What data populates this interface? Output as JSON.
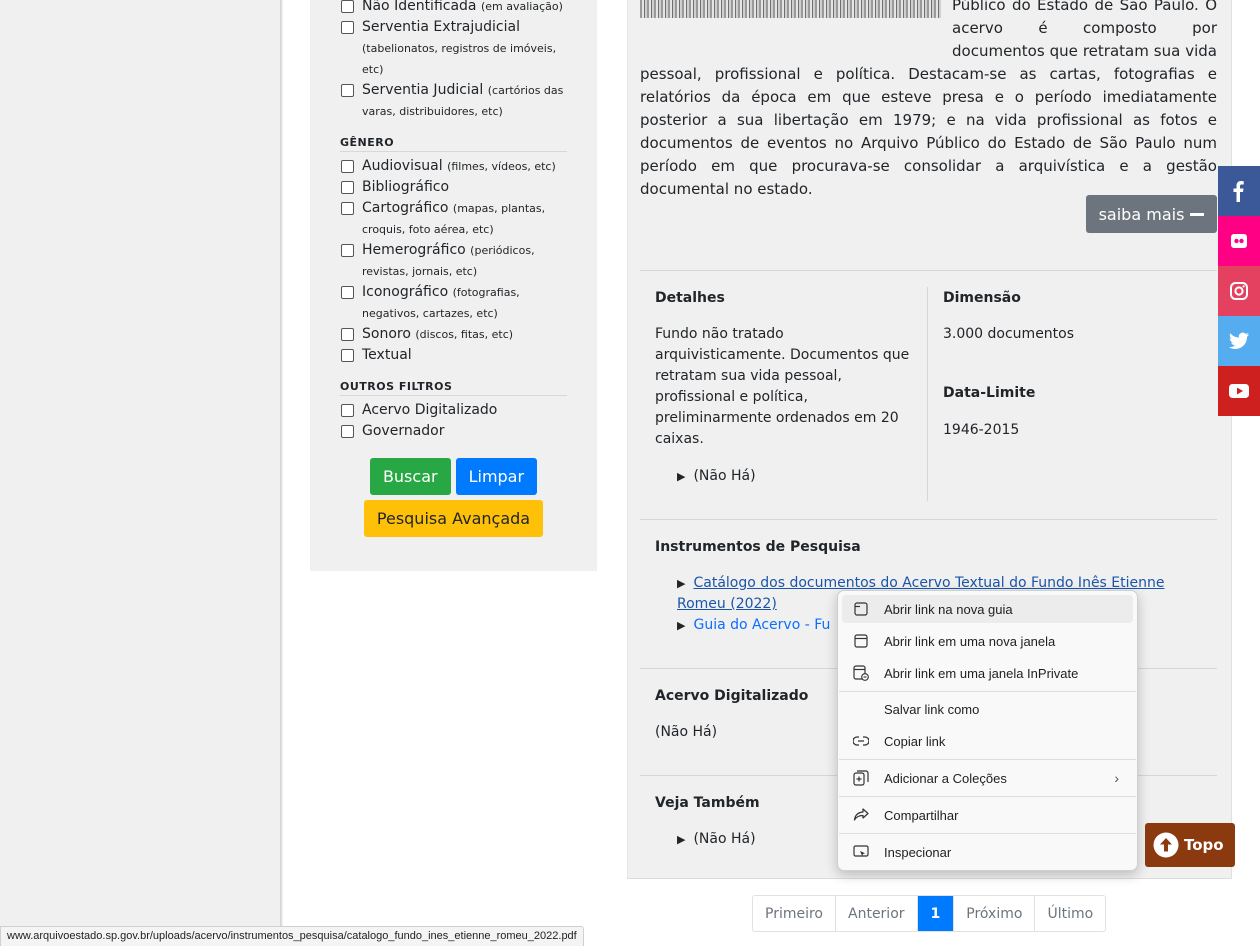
{
  "filters": {
    "items_top": [
      {
        "label": "Não Identificada",
        "note": "(em avaliação)"
      },
      {
        "label": "Serventia Extrajudicial",
        "note": "(tabelionatos, registros de imóveis, etc)"
      },
      {
        "label": "Serventia Judicial",
        "note": "(cartórios das varas, distribuidores, etc)"
      }
    ],
    "genero_title": "GÊNERO",
    "genero": [
      {
        "label": "Audiovisual",
        "note": "(filmes, vídeos, etc)"
      },
      {
        "label": "Bibliográfico",
        "note": ""
      },
      {
        "label": "Cartográfico",
        "note": "(mapas, plantas, croquis, foto aérea, etc)"
      },
      {
        "label": "Hemerográfico",
        "note": "(periódicos, revistas, jornais, etc)"
      },
      {
        "label": "Iconográfico",
        "note": "(fotografias, negativos, cartazes, etc)"
      },
      {
        "label": "Sonoro",
        "note": "(discos, fitas, etc)"
      },
      {
        "label": "Textual",
        "note": ""
      }
    ],
    "outros_title": "OUTROS FILTROS",
    "outros": [
      {
        "label": "Acervo Digitalizado",
        "note": ""
      },
      {
        "label": "Governador",
        "note": ""
      }
    ],
    "buscar_label": "Buscar",
    "limpar_label": "Limpar",
    "avancada_label": "Pesquisa Avançada"
  },
  "description": {
    "text": "Público do Estado de São Paulo. O acervo é composto por documentos que retratam sua vida pessoal, profissional e política. Destacam-se as cartas, fotografias e relatórios da época em que esteve presa e o período imediatamente posterior a sua libertação em 1979; e na vida profissional as fotos e documentos de eventos no Arquivo Público do Estado de São Paulo num período em que procurava-se consolidar a arquivística e a gestão documental no estado.",
    "saiba_label": "saiba mais"
  },
  "details": {
    "detalhes_title": "Detalhes",
    "detalhes_text": "Fundo não tratado arquivisticamente. Documentos que retratam sua vida pessoal, profissional e política, preliminarmente ordenados em 20 caixas.",
    "detalhes_item": "(Não Há)",
    "dimensao_title": "Dimensão",
    "dimensao_value": "3.000 documentos",
    "data_limite_title": "Data-Limite",
    "data_limite_value": "1946-2015"
  },
  "instrumentos": {
    "title": "Instrumentos de Pesquisa",
    "link1": "Catálogo dos documentos do Acervo Textual do Fundo Inês Etienne Romeu (2022)",
    "link2": "Guia do Acervo - Fu"
  },
  "acervo": {
    "title": "Acervo Digitalizado",
    "value": "(Não Há)"
  },
  "veja": {
    "title": "Veja Também",
    "item": "(Não Há)"
  },
  "context_menu": {
    "open_new_tab": "Abrir link na nova guia",
    "open_new_window": "Abrir link em uma nova janela",
    "open_inprivate": "Abrir link em uma janela InPrivate",
    "save_link": "Salvar link como",
    "copy_link": "Copiar link",
    "add_collections": "Adicionar a Coleções",
    "share": "Compartilhar",
    "inspect": "Inspecionar"
  },
  "social": {
    "colors": {
      "facebook": "#3b5998",
      "flickr": "#ff0084",
      "instagram": "#e4405f",
      "twitter": "#55acee",
      "youtube": "#cd201f"
    }
  },
  "topo_label": "Topo",
  "pagination": {
    "first": "Primeiro",
    "prev": "Anterior",
    "current": "1",
    "next": "Próximo",
    "last": "Último"
  },
  "status_url": "www.arquivoestado.sp.gov.br/uploads/acervo/instrumentos_pesquisa/catalogo_fundo_ines_etienne_romeu_2022.pdf"
}
